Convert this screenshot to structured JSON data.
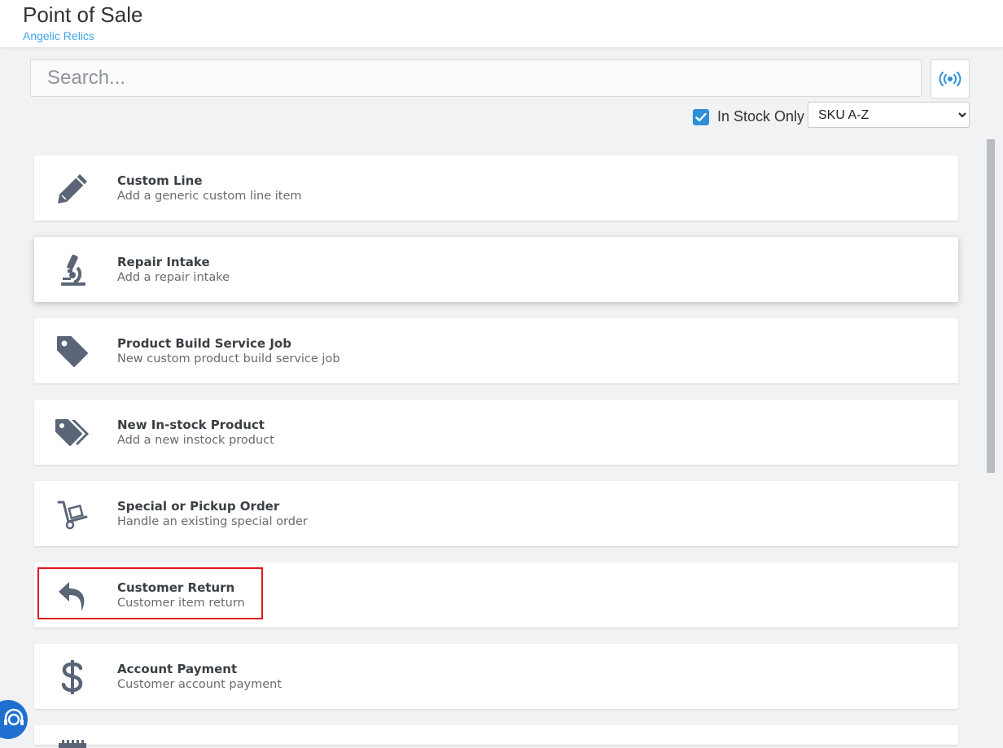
{
  "header": {
    "title": "Point of Sale",
    "subtitle": "Angelic Relics"
  },
  "search": {
    "placeholder": "Search...",
    "value": ""
  },
  "filters": {
    "in_stock_label": "In Stock Only",
    "in_stock_checked": true,
    "sort_selected": "SKU A-Z"
  },
  "items": [
    {
      "name": "Custom Line",
      "desc": "Add a generic custom line item",
      "icon": "pencil-icon"
    },
    {
      "name": "Repair Intake",
      "desc": "Add a repair intake",
      "icon": "microscope-icon"
    },
    {
      "name": "Product Build Service Job",
      "desc": "New custom product build service job",
      "icon": "tag-icon"
    },
    {
      "name": "New In-stock Product",
      "desc": "Add a new instock product",
      "icon": "tags-icon"
    },
    {
      "name": "Special or Pickup Order",
      "desc": "Handle an existing special order",
      "icon": "dolly-icon"
    },
    {
      "name": "Customer Return",
      "desc": "Customer item return",
      "icon": "reply-arrow-icon"
    },
    {
      "name": "Account Payment",
      "desc": "Customer account payment",
      "icon": "dollar-sign-icon"
    }
  ],
  "colors": {
    "accent": "#2d8fd9",
    "subtitle": "#3fa6e8",
    "icon": "#5a6577",
    "highlight": "#e0181f",
    "help_widget": "#1f6fd1"
  }
}
